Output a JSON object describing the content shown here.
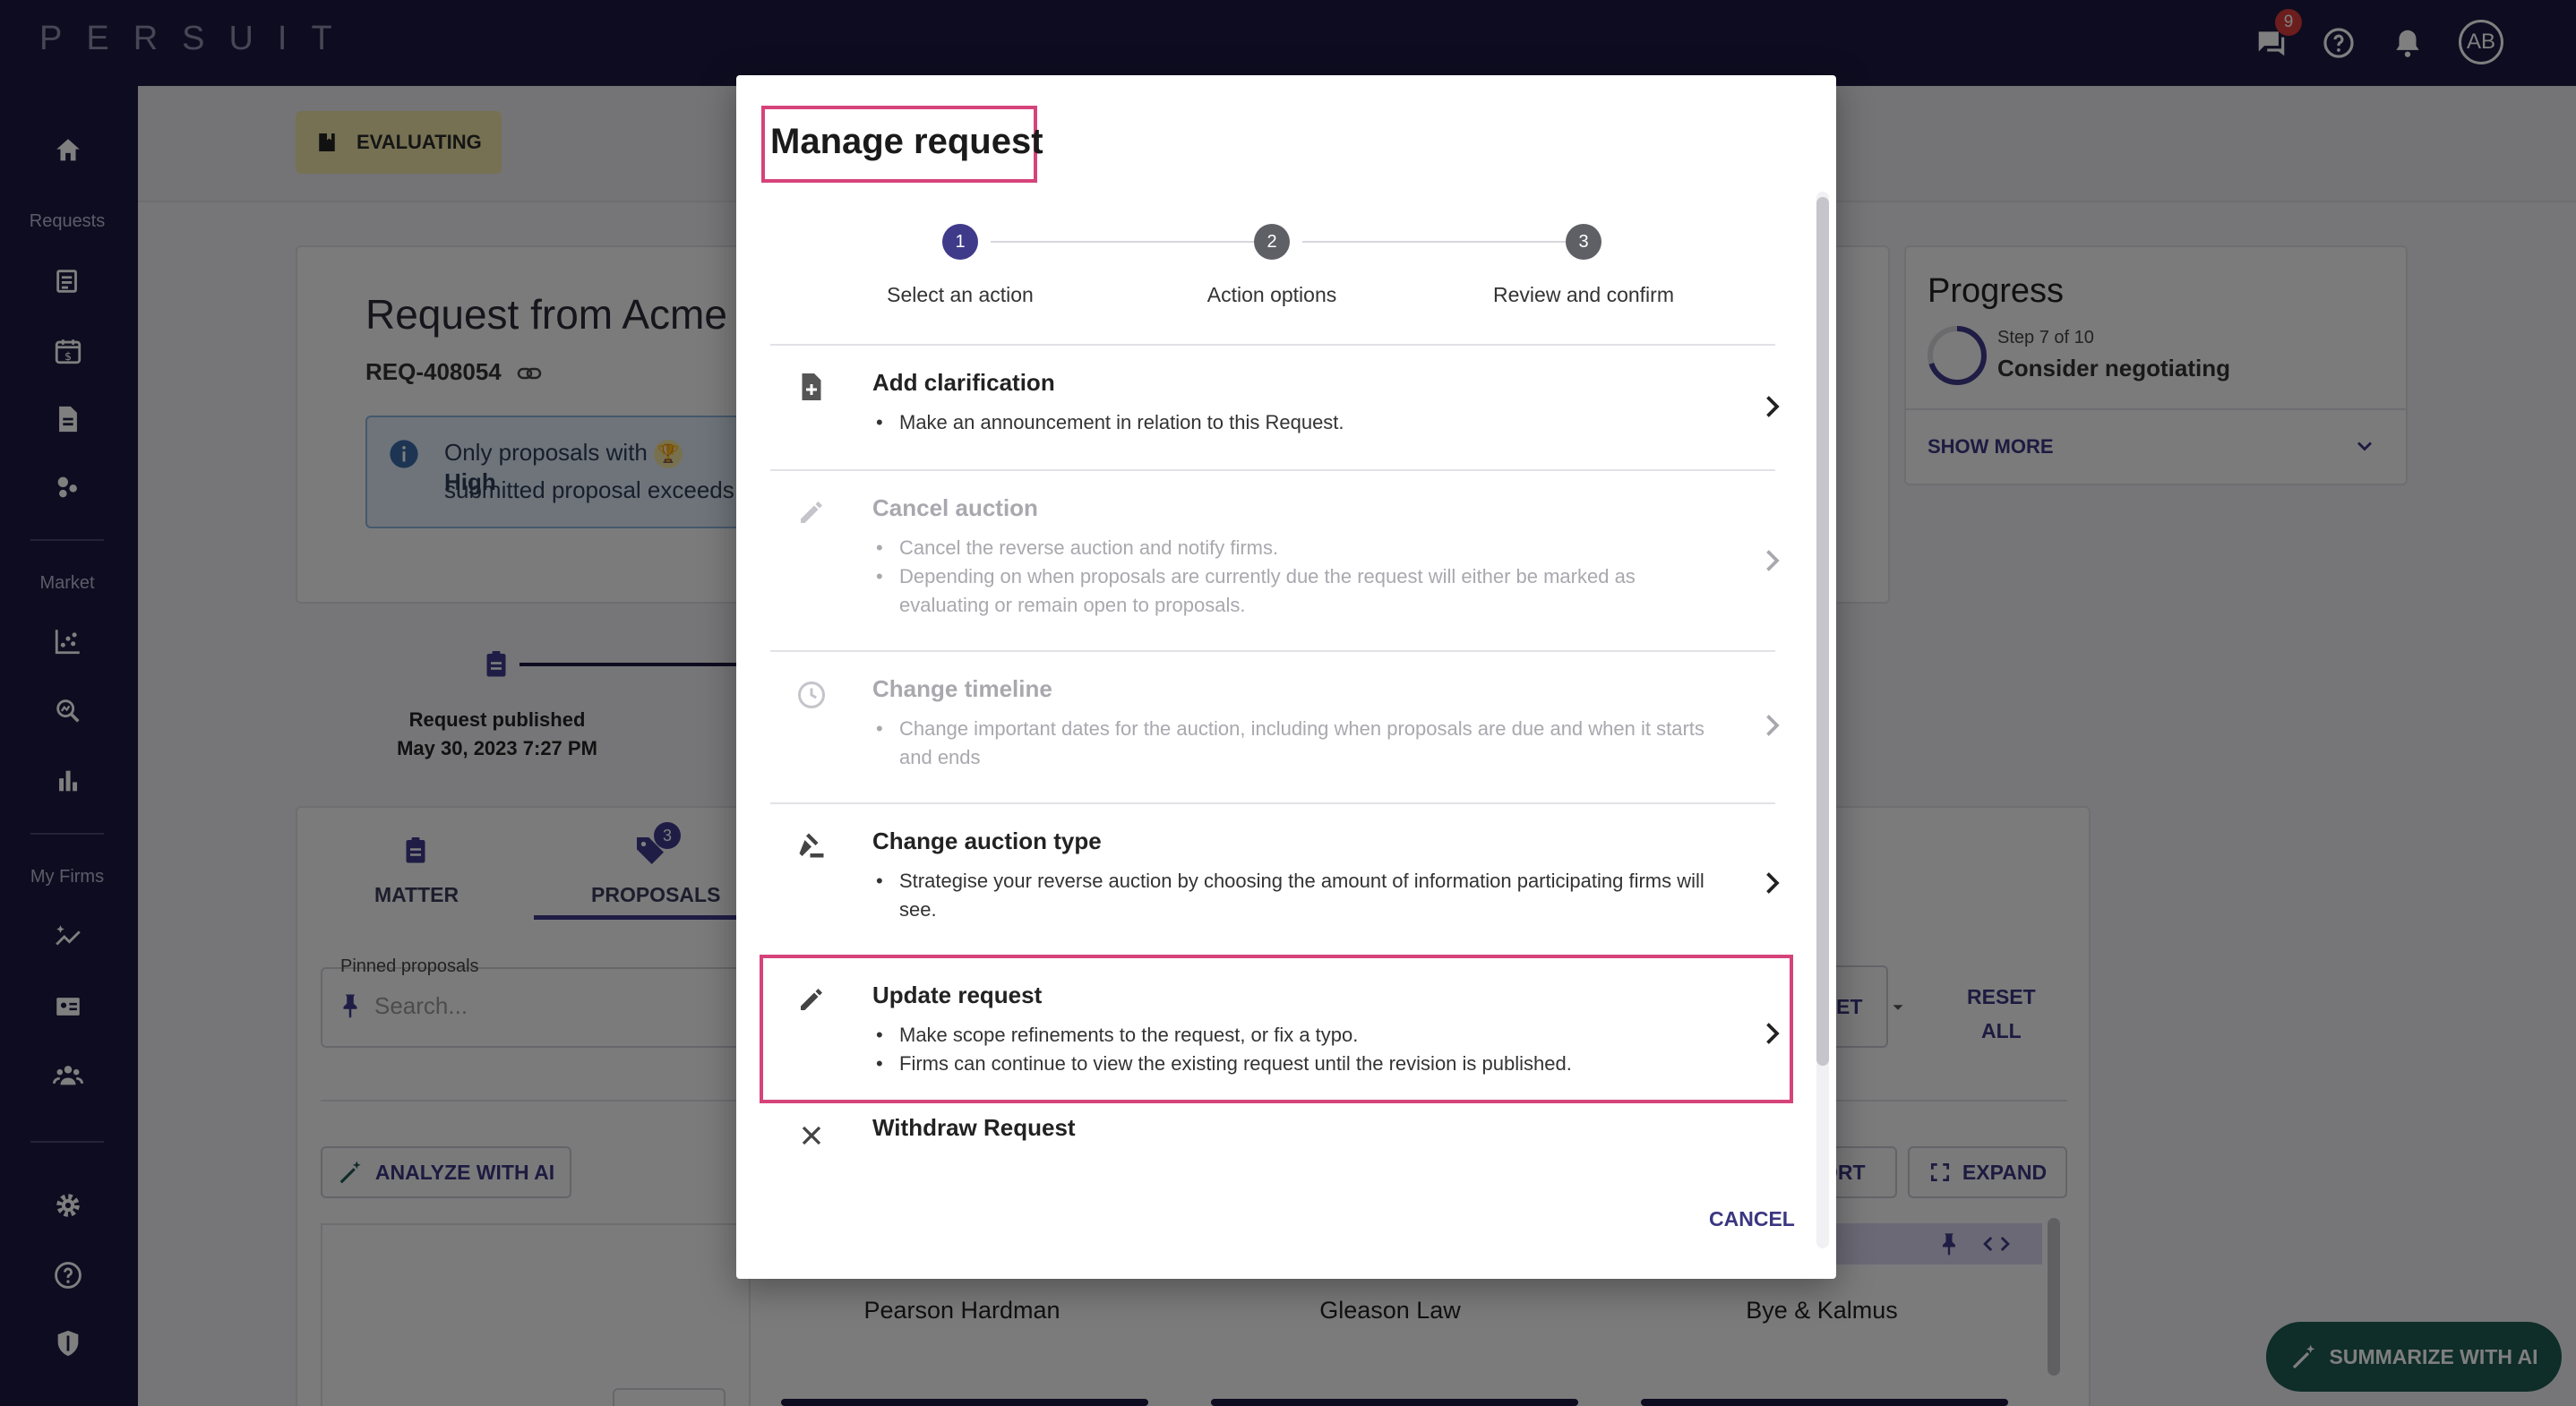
{
  "topbar": {
    "logo": "PERSUIT",
    "messages_badge": "9",
    "avatar_initials": "AB"
  },
  "sidebar": {
    "sections": [
      "Requests",
      "Market",
      "My Firms"
    ]
  },
  "background": {
    "status_chip": "EVALUATING",
    "request_title": "Request from Acme",
    "request_id": "REQ-408054",
    "info_line1": "Only proposals with",
    "info_line1_tail": "High",
    "info_line2": "submitted proposal exceeds",
    "timeline_label": "Request published",
    "timeline_date": "May 30, 2023 7:27 PM",
    "tabs": [
      {
        "label": "MATTER"
      },
      {
        "label": "PROPOSALS",
        "badge": "3"
      }
    ],
    "pinned_label": "Pinned proposals",
    "pinned_placeholder": "Search...",
    "select_partial": "ET",
    "reset_all": [
      "RESET",
      "ALL"
    ],
    "analyze_button": "ANALYZE WITH AI",
    "sort_partial": "ORT",
    "expand_button": "EXPAND",
    "firms": [
      "Pearson Hardman",
      "Gleason Law",
      "Bye & Kalmus"
    ],
    "progress": {
      "title": "Progress",
      "step_small": "Step 7 of 10",
      "step_big": "Consider negotiating",
      "show_more": "SHOW MORE"
    },
    "summarize_button": "SUMMARIZE WITH AI"
  },
  "modal": {
    "title": "Manage request",
    "steps": [
      {
        "number": "1",
        "label": "Select an action",
        "state": "active"
      },
      {
        "number": "2",
        "label": "Action options",
        "state": "inactive"
      },
      {
        "number": "3",
        "label": "Review and confirm",
        "state": "inactive"
      }
    ],
    "actions": [
      {
        "title": "Add clarification",
        "icon": "note-add-icon",
        "enabled": true,
        "bullets": [
          "Make an announcement in relation to this Request."
        ]
      },
      {
        "title": "Cancel auction",
        "icon": "pencil-icon",
        "enabled": false,
        "bullets": [
          "Cancel the reverse auction and notify firms.",
          "Depending on when proposals are currently due the request will either be marked as evaluating or remain open to proposals."
        ]
      },
      {
        "title": "Change timeline",
        "icon": "clock-icon",
        "enabled": false,
        "bullets": [
          "Change important dates for the auction, including when proposals are due and when it starts and ends"
        ]
      },
      {
        "title": "Change auction type",
        "icon": "gavel-icon",
        "enabled": true,
        "bullets": [
          "Strategise your reverse auction by choosing the amount of information participating firms will see."
        ]
      },
      {
        "title": "Update request",
        "icon": "pencil-icon",
        "enabled": true,
        "bullets": [
          "Make scope refinements to the request, or fix a typo.",
          "Firms can continue to view the existing request until the revision is published."
        ]
      },
      {
        "title": "Withdraw Request",
        "icon": "close-icon",
        "enabled": true,
        "bullets": []
      }
    ],
    "cancel_label": "CANCEL"
  },
  "colors": {
    "nav_bg": "#1c1840",
    "accent": "#3a3680",
    "step_active": "#3f3a8a",
    "step_inactive": "#5f5f66",
    "highlight": "#d6437a"
  }
}
